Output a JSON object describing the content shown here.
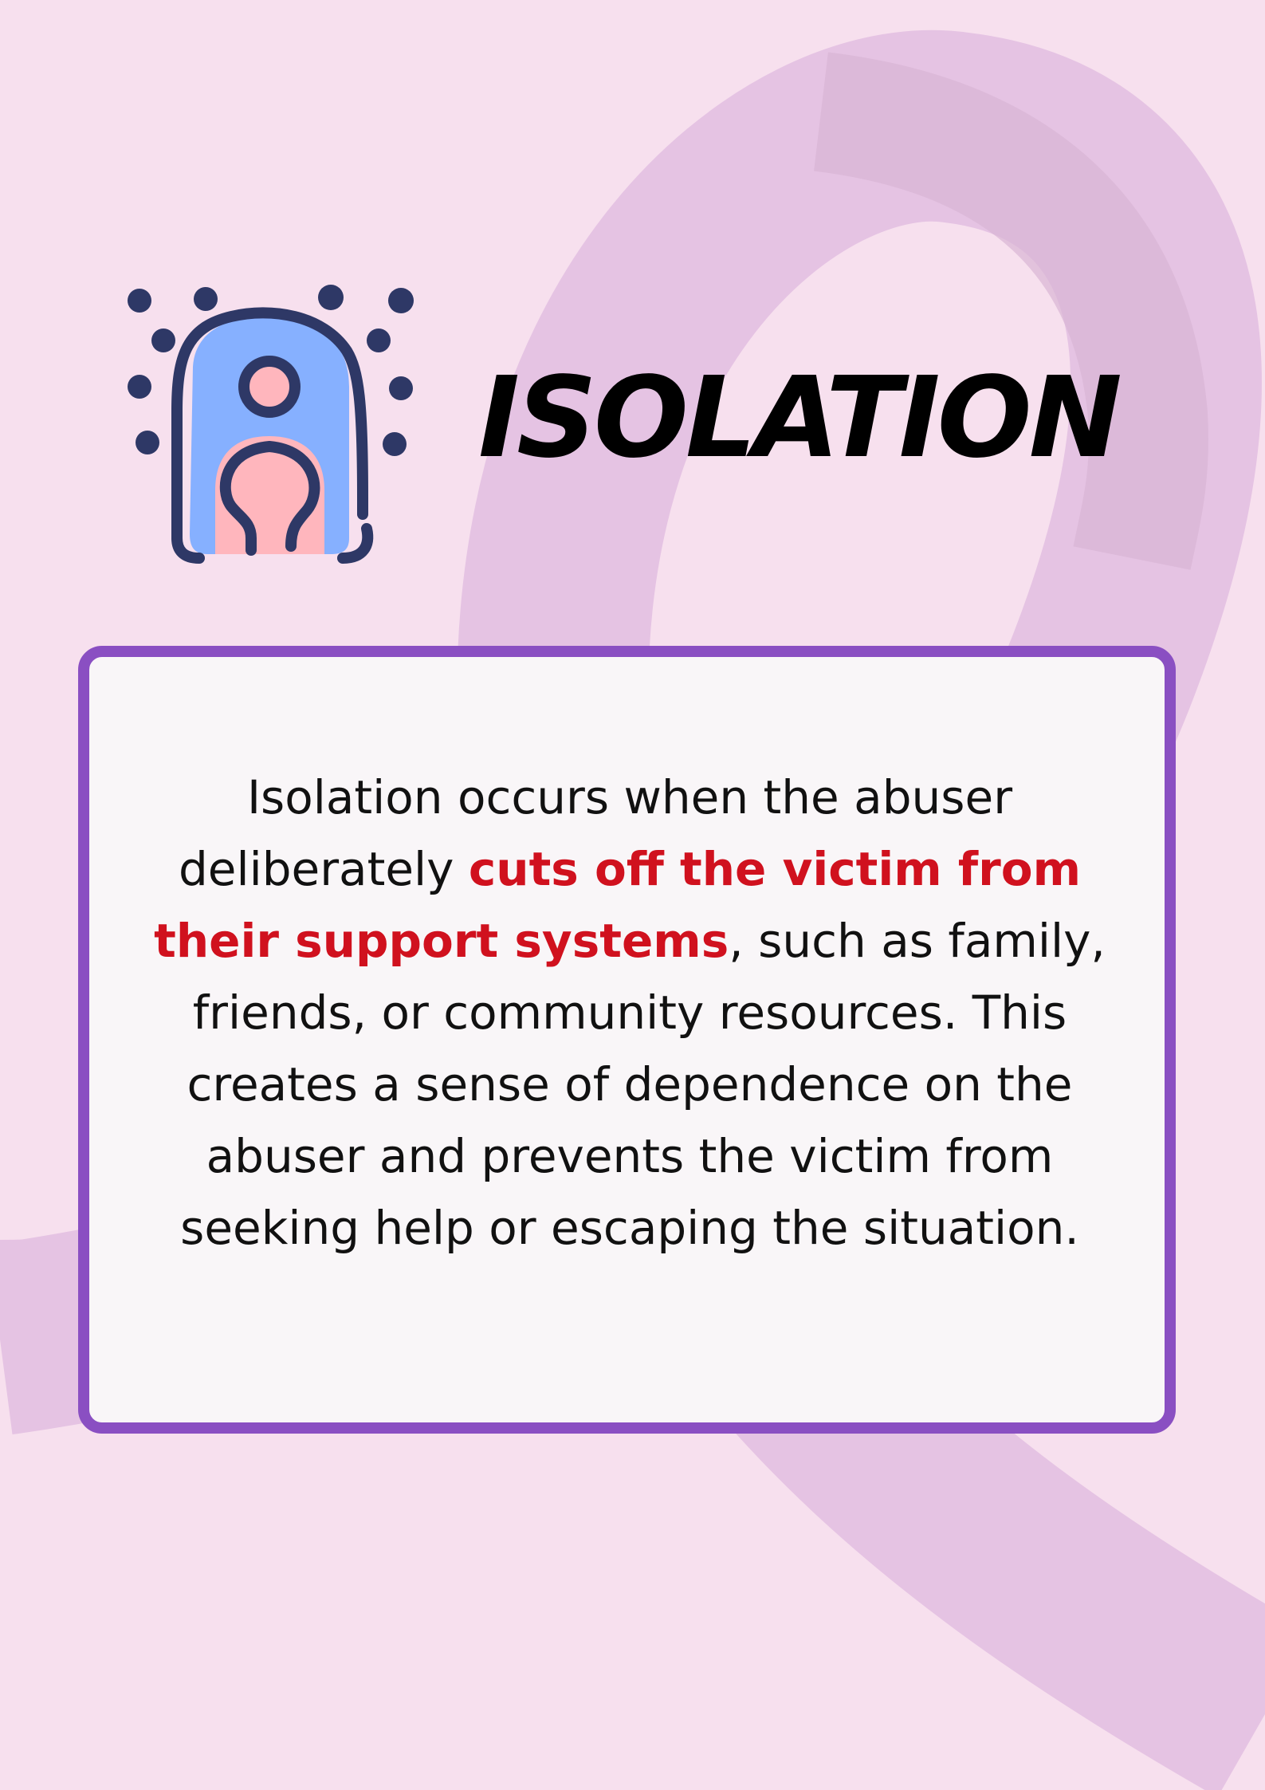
{
  "title": "ISOLATION",
  "icon": "isolated-person-icon",
  "body": {
    "intro": "Isolation occurs when the abuser deliberately ",
    "highlight": "cuts off the victim from their support systems",
    "rest": ", such as family, friends, or community resources. This creates a sense of dependence on the abuser and prevents the victim from seeking help or escaping the situation."
  },
  "colors": {
    "background": "#f7e0ee",
    "ribbon": "#e5c3e3",
    "card_border": "#8a4fc2",
    "card_fill": "#f9f6f8",
    "highlight": "#d0111e",
    "icon_outline": "#2e3866",
    "icon_fill": "#86b0ff",
    "icon_figure": "#ffb6bd"
  }
}
